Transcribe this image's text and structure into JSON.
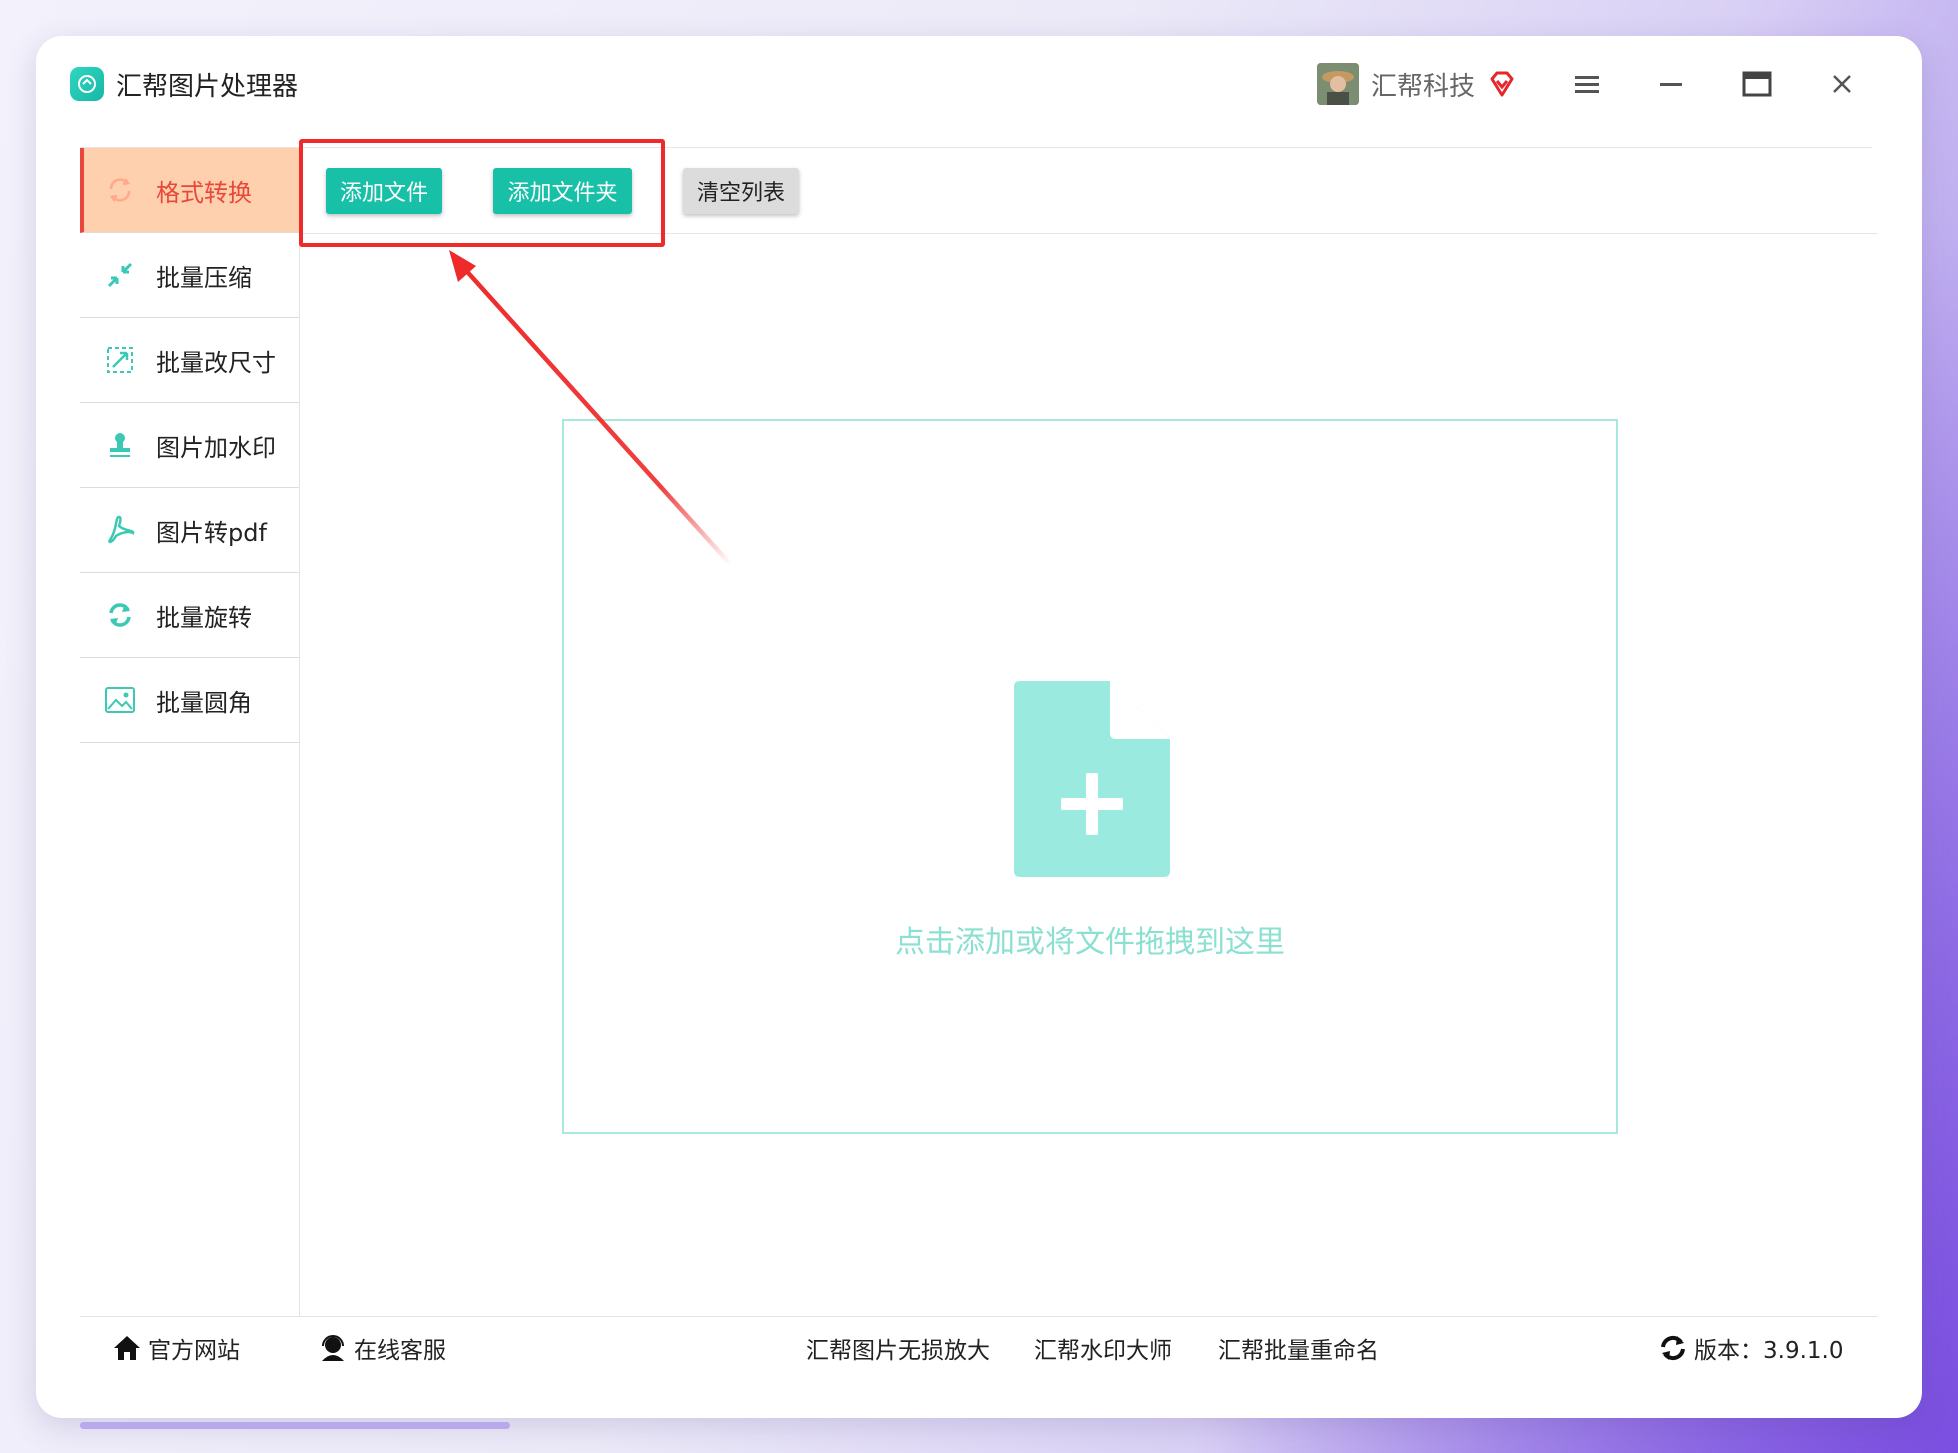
{
  "app": {
    "title": "汇帮图片处理器"
  },
  "user": {
    "name": "汇帮科技"
  },
  "sidebar": {
    "items": [
      {
        "label": "格式转换",
        "icon": "convert-icon",
        "active": true
      },
      {
        "label": "批量压缩",
        "icon": "compress-icon",
        "active": false
      },
      {
        "label": "批量改尺寸",
        "icon": "resize-icon",
        "active": false
      },
      {
        "label": "图片加水印",
        "icon": "stamp-icon",
        "active": false
      },
      {
        "label": "图片转pdf",
        "icon": "pdf-icon",
        "active": false
      },
      {
        "label": "批量旋转",
        "icon": "rotate-icon",
        "active": false
      },
      {
        "label": "批量圆角",
        "icon": "image-icon",
        "active": false
      }
    ]
  },
  "toolbar": {
    "add_file": "添加文件",
    "add_folder": "添加文件夹",
    "clear_list": "清空列表"
  },
  "dropzone": {
    "hint": "点击添加或将文件拖拽到这里"
  },
  "footer": {
    "official_site": "官方网站",
    "online_service": "在线客服",
    "links": [
      "汇帮图片无损放大",
      "汇帮水印大师",
      "汇帮批量重命名"
    ],
    "version": "版本：3.9.1.0"
  },
  "colors": {
    "accent": "#19c0a8",
    "active_bg": "#ffd0ad",
    "active_text": "#e8473b",
    "highlight": "#ee2a2a",
    "drop_icon": "#9beadf"
  }
}
